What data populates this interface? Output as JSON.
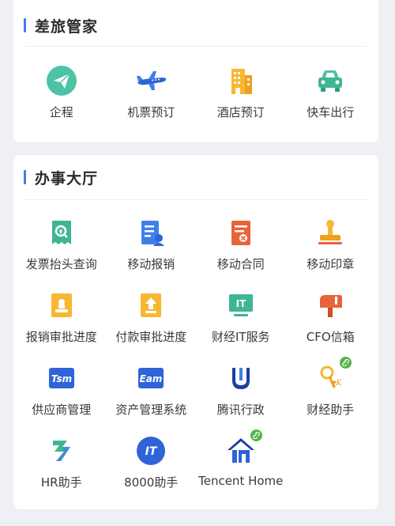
{
  "travel": {
    "title": "差旅管家",
    "items": [
      {
        "label": "企程",
        "icon": "paper-plane-icon"
      },
      {
        "label": "机票预订",
        "icon": "airplane-icon"
      },
      {
        "label": "酒店预订",
        "icon": "hotel-building-icon"
      },
      {
        "label": "快车出行",
        "icon": "car-icon"
      }
    ]
  },
  "hall": {
    "title": "办事大厅",
    "items": [
      {
        "label": "发票抬头查询",
        "icon": "invoice-search-icon"
      },
      {
        "label": "移动报销",
        "icon": "expense-report-icon"
      },
      {
        "label": "移动合同",
        "icon": "contract-icon"
      },
      {
        "label": "移动印章",
        "icon": "stamp-icon"
      },
      {
        "label": "报销审批进度",
        "icon": "expense-approval-icon"
      },
      {
        "label": "付款审批进度",
        "icon": "payment-approval-icon"
      },
      {
        "label": "财经IT服务",
        "icon": "it-monitor-icon"
      },
      {
        "label": "CFO信箱",
        "icon": "mailbox-icon"
      },
      {
        "label": "供应商管理",
        "icon": "tsm-icon",
        "icon_text": "Tsm"
      },
      {
        "label": "资产管理系统",
        "icon": "eam-icon",
        "icon_text": "Eam"
      },
      {
        "label": "腾讯行政",
        "icon": "tencent-admin-icon"
      },
      {
        "label": "财经助手",
        "icon": "finance-assistant-icon",
        "badge": "link-badge-icon"
      },
      {
        "label": "HR助手",
        "icon": "hr-assistant-icon"
      },
      {
        "label": "8000助手",
        "icon": "it-8000-icon",
        "icon_text": "IT"
      },
      {
        "label": "Tencent Home",
        "icon": "tencent-home-icon",
        "badge": "link-badge-icon"
      }
    ]
  },
  "colors": {
    "accent_bar": "#3f7fe8",
    "page_background": "#eef0f4",
    "badge_green": "#53b548"
  }
}
